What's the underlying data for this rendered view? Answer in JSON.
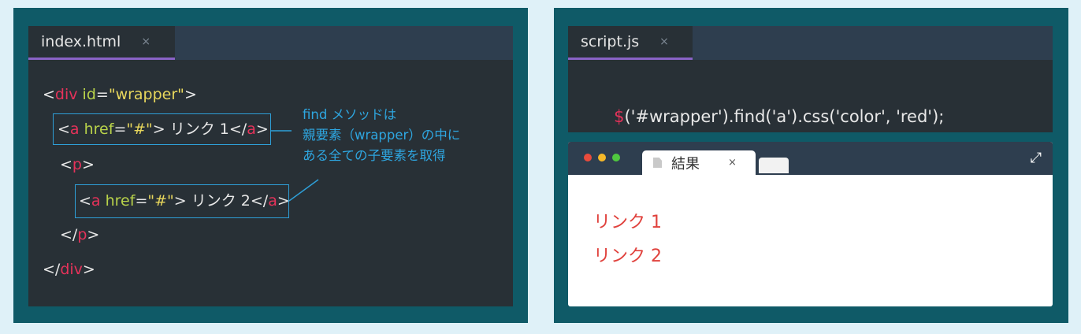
{
  "left_editor": {
    "tab_name": "index.html",
    "tab_close": "×",
    "lines": [
      {
        "parts": [
          [
            "t",
            "<"
          ],
          [
            "p",
            "div"
          ],
          [
            "g",
            " id"
          ],
          [
            "t",
            "="
          ],
          [
            "y",
            "\"wrapper\""
          ],
          [
            "t",
            ">"
          ]
        ]
      },
      {
        "parts": [
          [
            "t",
            "<"
          ],
          [
            "p",
            "a"
          ],
          [
            "g",
            " href"
          ],
          [
            "t",
            "="
          ],
          [
            "y",
            "\"#\""
          ],
          [
            "t",
            "> リンク 1</"
          ],
          [
            "p",
            "a"
          ],
          [
            "t",
            ">"
          ]
        ]
      },
      {
        "parts": [
          [
            "t",
            "<"
          ],
          [
            "p",
            "p"
          ],
          [
            "t",
            ">"
          ]
        ]
      },
      {
        "parts": [
          [
            "t",
            "<"
          ],
          [
            "p",
            "a"
          ],
          [
            "g",
            " href"
          ],
          [
            "t",
            "="
          ],
          [
            "y",
            "\"#\""
          ],
          [
            "t",
            "> リンク 2</"
          ],
          [
            "p",
            "a"
          ],
          [
            "t",
            ">"
          ]
        ]
      },
      {
        "parts": [
          [
            "t",
            "</"
          ],
          [
            "p",
            "p"
          ],
          [
            "t",
            ">"
          ]
        ]
      },
      {
        "parts": [
          [
            "t",
            "</"
          ],
          [
            "p",
            "div"
          ],
          [
            "t",
            ">"
          ]
        ]
      }
    ],
    "note": "find メソッドは\n親要素（wrapper）の中に\nある全ての子要素を取得"
  },
  "right_editor": {
    "tab_name": "script.js",
    "tab_close": "×",
    "code": {
      "dollar": "$",
      "rest": "('#wrapper').find('a').css('color', 'red');"
    }
  },
  "browser": {
    "tab_title": "結果",
    "tab_close": "×",
    "expand_icon": "⤢",
    "dot_colors": [
      "#e94b3c",
      "#f5b829",
      "#4fc83f"
    ],
    "results": [
      "リンク 1",
      "リンク 2"
    ],
    "result_color": "#e0413c"
  }
}
